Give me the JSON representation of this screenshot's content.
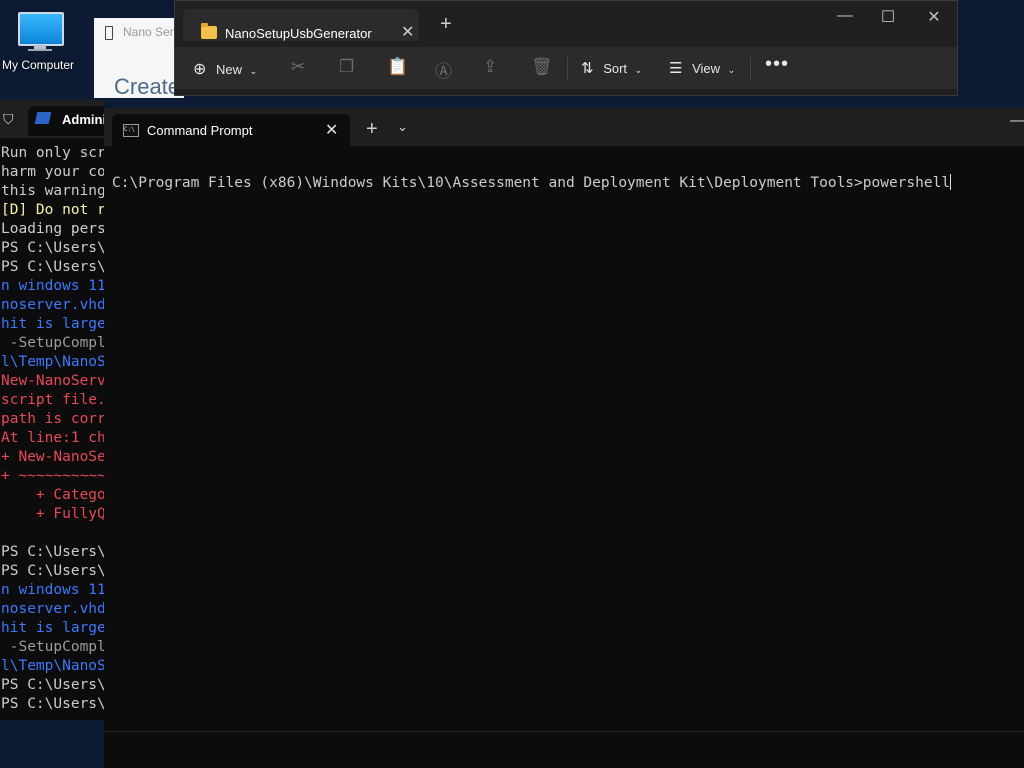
{
  "desktop": {
    "icon_label": "My Computer",
    "icon": "computer-icon"
  },
  "nano_window": {
    "title": "Nano Serv",
    "heading": "Create"
  },
  "explorer": {
    "tab_title": "NanoSetupUsbGenerator",
    "toolbar": {
      "new_label": "New",
      "sort_label": "Sort",
      "view_label": "View"
    }
  },
  "powershell": {
    "tab_title": "Adminis",
    "lines": [
      {
        "text": "Run only scr",
        "color": "#cccccc"
      },
      {
        "text": "harm your co",
        "color": "#cccccc"
      },
      {
        "text": "this warning",
        "color": "#cccccc"
      },
      {
        "text": "[D] Do not r",
        "color": "#f9f1a5"
      },
      {
        "text": "Loading pers",
        "color": "#cccccc"
      },
      {
        "text": "PS C:\\Users\\",
        "color": "#cccccc"
      },
      {
        "text": "PS C:\\Users\\",
        "color": "#cccccc"
      },
      {
        "text": "n windows 11",
        "color": "#3b78ff"
      },
      {
        "text": "noserver.vhd",
        "color": "#3b78ff"
      },
      {
        "text": "hit is large",
        "color": "#3b78ff"
      },
      {
        "text": " -SetupCompl",
        "color": "#9a9a9a"
      },
      {
        "text": "l\\Temp\\NanoS",
        "color": "#3b78ff"
      },
      {
        "text": "New-NanoServ",
        "color": "#e74856"
      },
      {
        "text": "script file.",
        "color": "#e74856"
      },
      {
        "text": "path is corr",
        "color": "#e74856"
      },
      {
        "text": "At line:1 ch",
        "color": "#e74856"
      },
      {
        "text": "+ New-NanoSe",
        "color": "#e74856"
      },
      {
        "text": "+ ~~~~~~~~~~",
        "color": "#e74856"
      },
      {
        "text": "    + Catego",
        "color": "#e74856"
      },
      {
        "text": "    + FullyQ",
        "color": "#e74856"
      },
      {
        "text": "",
        "color": "#cccccc"
      },
      {
        "text": "PS C:\\Users\\",
        "color": "#cccccc"
      },
      {
        "text": "PS C:\\Users\\",
        "color": "#cccccc"
      },
      {
        "text": "n windows 11",
        "color": "#3b78ff"
      },
      {
        "text": "noserver.vhd",
        "color": "#3b78ff"
      },
      {
        "text": "hit is large",
        "color": "#3b78ff"
      },
      {
        "text": " -SetupCompl",
        "color": "#9a9a9a"
      },
      {
        "text": "l\\Temp\\NanoS",
        "color": "#3b78ff"
      },
      {
        "text": "PS C:\\Users\\",
        "color": "#cccccc"
      },
      {
        "text": "PS C:\\Users\\",
        "color": "#cccccc"
      }
    ]
  },
  "cmd": {
    "tab_title": "Command Prompt",
    "prompt_line": "C:\\Program Files (x86)\\Windows Kits\\10\\Assessment and Deployment Kit\\Deployment Tools>powershell"
  }
}
